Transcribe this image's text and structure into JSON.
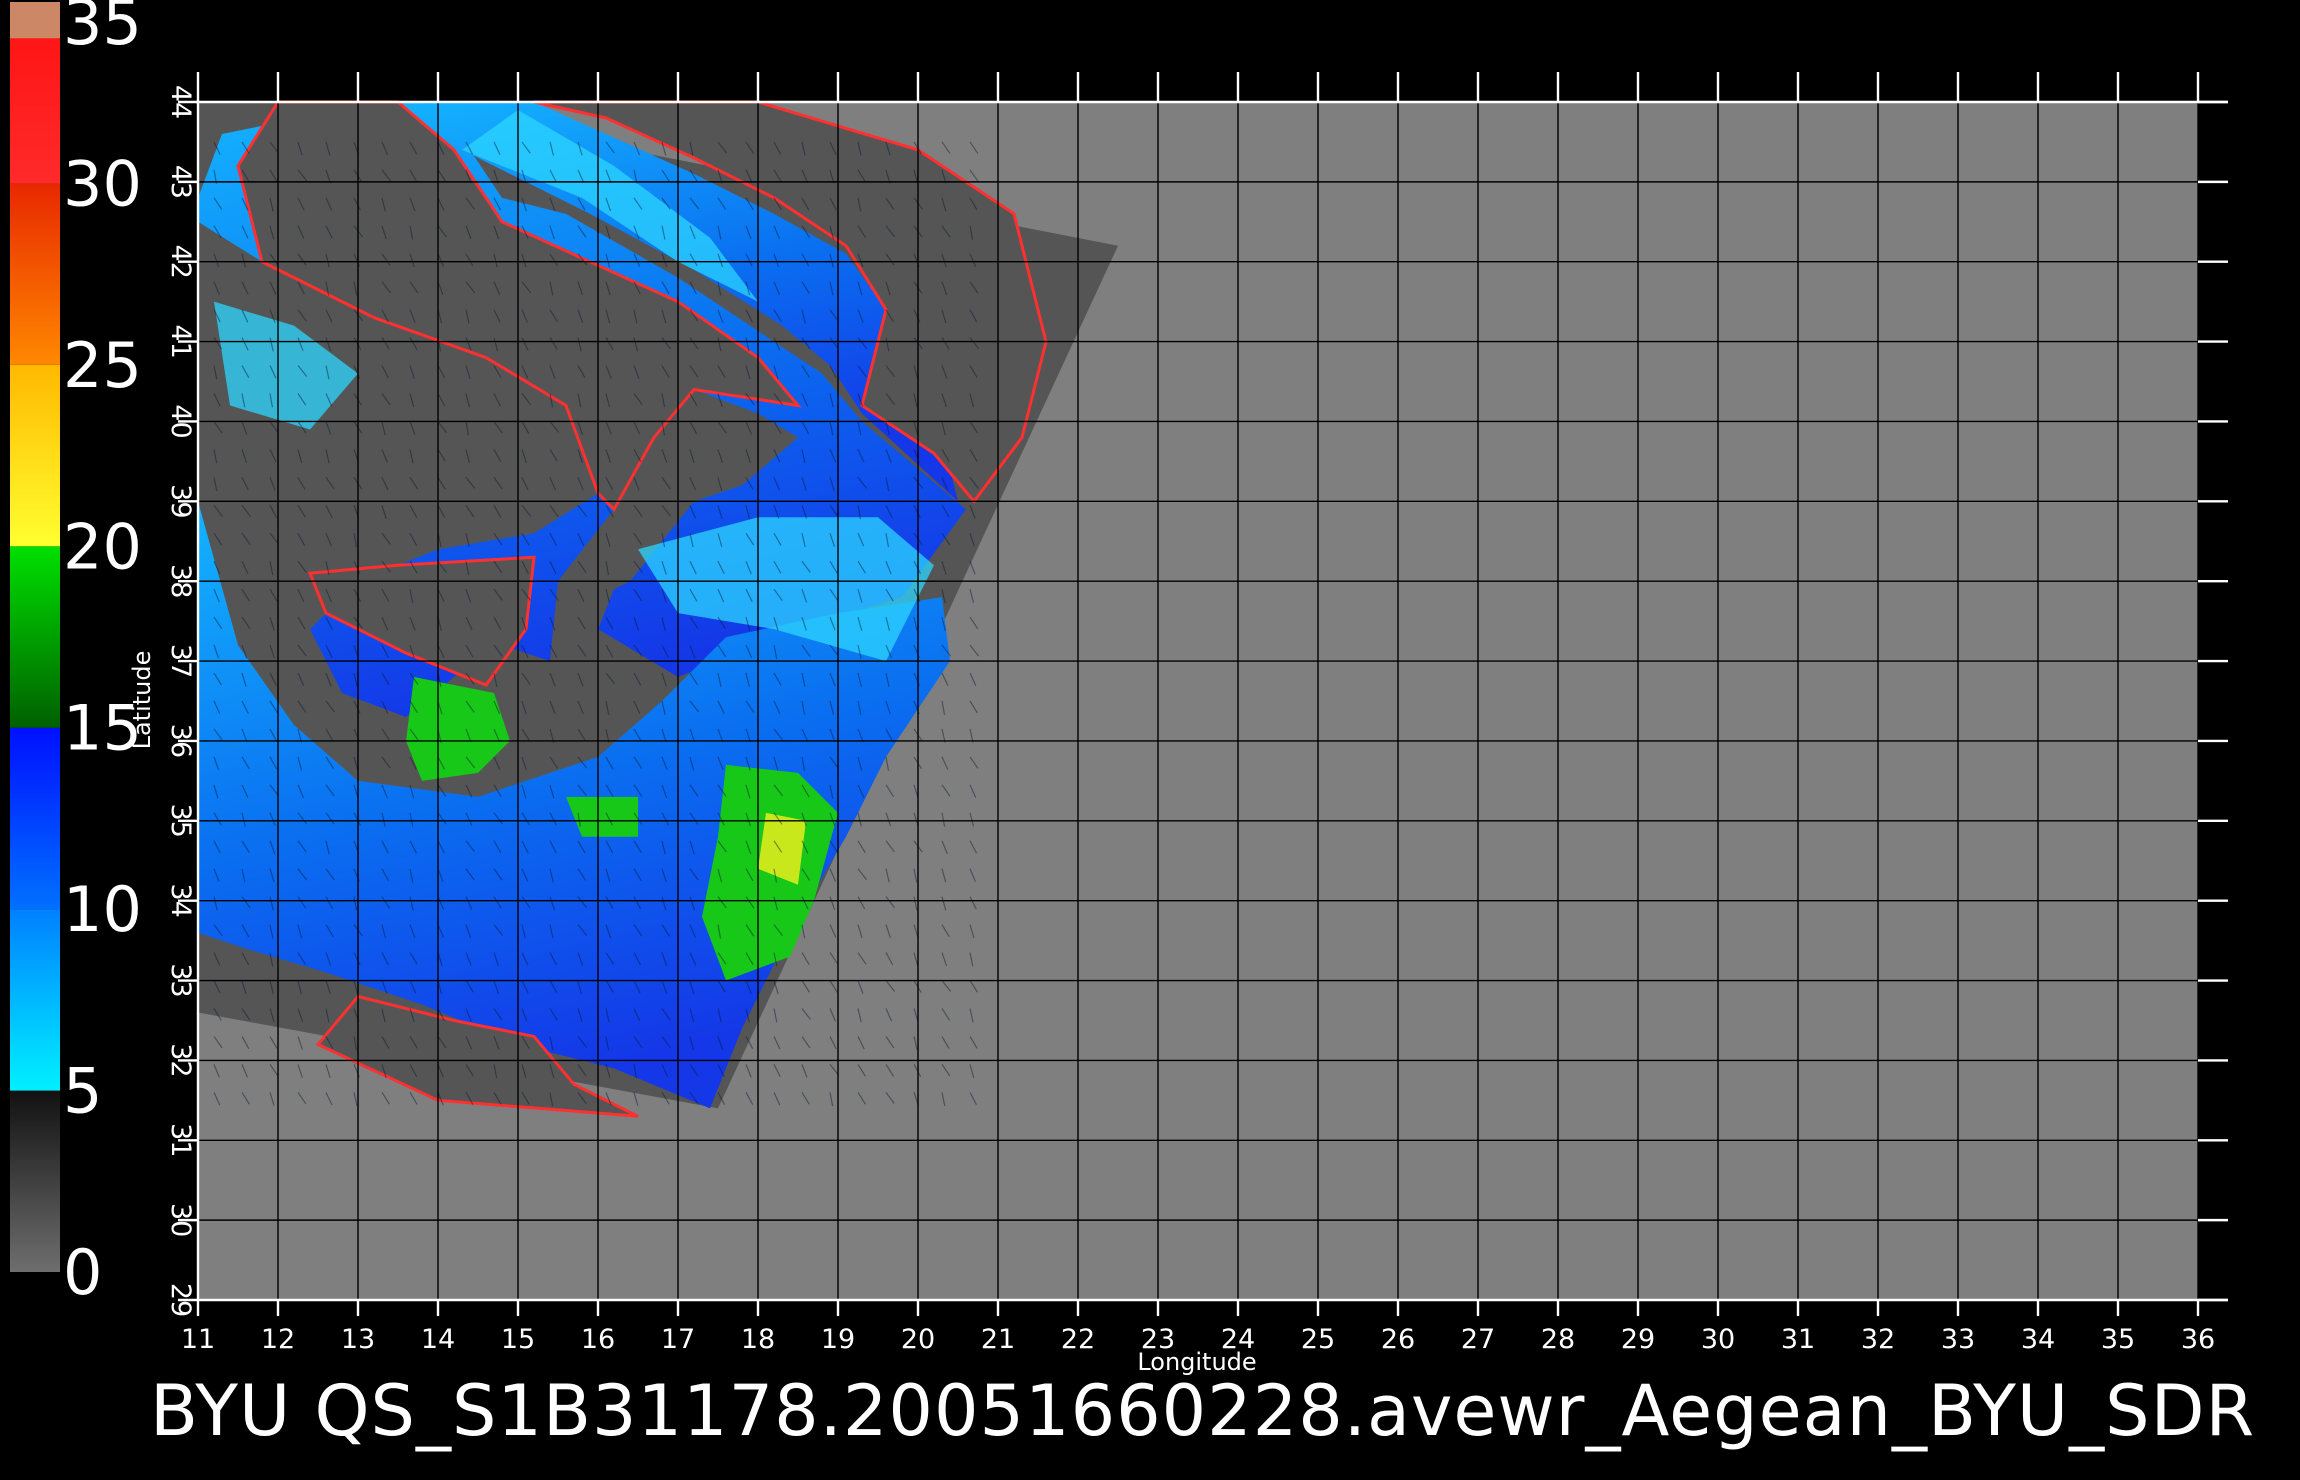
{
  "colorbar": {
    "labels": [
      "0",
      "5",
      "10",
      "15",
      "20",
      "25",
      "30",
      "35"
    ],
    "range": [
      0,
      35
    ],
    "stops": [
      {
        "from": 0,
        "to": 5,
        "colors": [
          "#6e6e6e",
          "#111111"
        ]
      },
      {
        "from": 5,
        "to": 10,
        "colors": [
          "#00f0ff",
          "#0080ff"
        ]
      },
      {
        "from": 10,
        "to": 15,
        "colors": [
          "#0070ff",
          "#0010ff"
        ]
      },
      {
        "from": 15,
        "to": 20,
        "colors": [
          "#006000",
          "#00e000"
        ]
      },
      {
        "from": 20,
        "to": 25,
        "colors": [
          "#ffff30",
          "#ffb800"
        ]
      },
      {
        "from": 25,
        "to": 30,
        "colors": [
          "#ff8800",
          "#e82800"
        ]
      },
      {
        "from": 30,
        "to": 35,
        "colors": [
          "#ff2a2a",
          "#ff1010"
        ]
      },
      {
        "from": 34,
        "to": 35,
        "colors": [
          "#cc8866",
          "#cc8866"
        ]
      }
    ]
  },
  "map": {
    "lon_range": [
      11,
      36
    ],
    "lat_range": [
      29,
      44
    ],
    "lon_ticks": [
      "11",
      "12",
      "13",
      "14",
      "15",
      "16",
      "17",
      "18",
      "19",
      "20",
      "21",
      "22",
      "23",
      "24",
      "25",
      "26",
      "27",
      "28",
      "29",
      "30",
      "31",
      "32",
      "33",
      "34",
      "35",
      "36"
    ],
    "lat_ticks": [
      "29",
      "30",
      "31",
      "32",
      "33",
      "34",
      "35",
      "36",
      "37",
      "38",
      "39",
      "40",
      "41",
      "42",
      "43",
      "44"
    ],
    "xlabel": "Longitude",
    "ylabel": "Latitude",
    "background_color": "#7f7f7f",
    "swath_color": "#555555",
    "grid_color": "#000000",
    "land_color": "#555555",
    "swath_corners": [
      [
        11,
        32.6
      ],
      [
        11,
        44
      ],
      [
        13.3,
        44
      ],
      [
        22.5,
        42.2
      ],
      [
        17.5,
        31.4
      ]
    ]
  },
  "footer": {
    "text": "BYU  QS_S1B31178.20051660228.avewr_Aegean_BYU_SDR"
  }
}
